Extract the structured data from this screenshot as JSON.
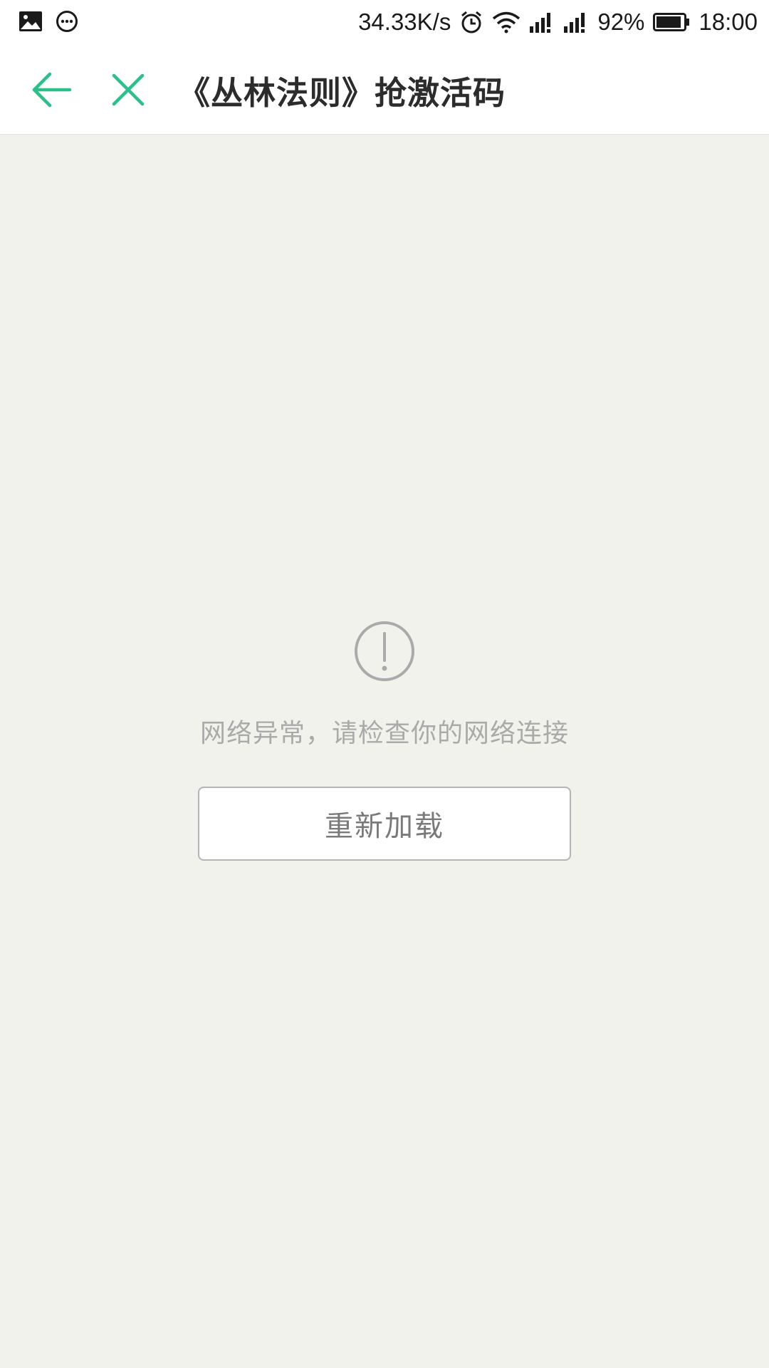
{
  "status_bar": {
    "left_icons": [
      "image-icon",
      "chat-bubble-icon"
    ],
    "network_speed": "34.33K/s",
    "right_icons": [
      "alarm-icon",
      "wifi-icon",
      "signal-1-icon",
      "signal-2-icon",
      "battery-icon"
    ],
    "battery_percent": "92%",
    "battery_level": 0.92,
    "time": "18:00"
  },
  "header": {
    "back_icon": "arrow-left-icon",
    "close_icon": "close-icon",
    "title": "《丛林法则》抢激活码",
    "accent_color": "#2bbf8a"
  },
  "error": {
    "icon": "exclamation-circle-icon",
    "message": "网络异常，请检查你的网络连接",
    "reload_label": "重新加载"
  }
}
